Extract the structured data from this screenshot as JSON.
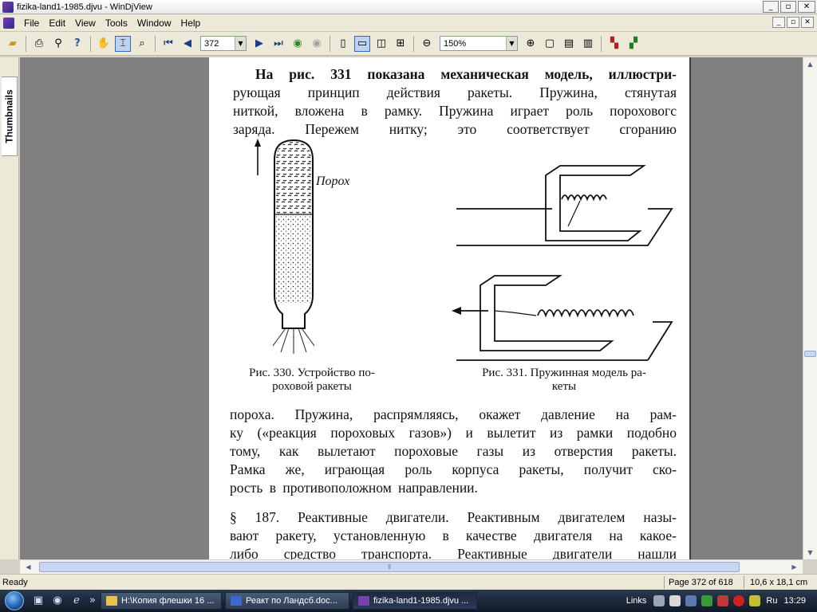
{
  "window": {
    "title": "fizika-land1-1985.djvu - WinDjView"
  },
  "window_buttons": {
    "minimize": "_",
    "maximize": "▫",
    "close": "✕"
  },
  "menu": [
    "File",
    "Edit",
    "View",
    "Tools",
    "Window",
    "Help"
  ],
  "toolbar": {
    "page_number": "372",
    "zoom": "150%"
  },
  "sidebar": {
    "tab_label": "Thumbnails"
  },
  "document": {
    "para1": [
      "На рис. 331 показана механическая модель, иллюстри-",
      "рующая принцип действия ракеты. Пружина, стянутая",
      "ниткой, вложена в рамку. Пружина играет роль пороховогс",
      "заряда. Пережем нитку; это соответствует сгоранию"
    ],
    "fig330_label": "Порох",
    "fig330_caption": [
      "Рис. 330. Устройство по-",
      "роховой ракеты"
    ],
    "fig331_caption": [
      "Рис. 331.  Пружинная  модель ра-",
      "кеты"
    ],
    "para2": [
      "пороха. Пружина, распрямляясь, окажет давление на  рам-",
      "ку («реакция пороховых газов») и вылетит из рамки подобно",
      "тому, как вылетают пороховые газы из отверстия ракеты.",
      "Рамка же, играющая роль корпуса ракеты, получит ско-",
      "рость  в  противоположном  направлении."
    ],
    "para3": [
      "§ 187. Реактивные двигатели. Реактивным двигателем назы-",
      "вают ракету, установленную в качестве двигателя на какое-",
      "либо средство транспорта. Реактивные двигатели нашли"
    ]
  },
  "status": {
    "left": "Ready",
    "page": "Page 372 of 618",
    "size": "10,6 x 18,1 cm"
  },
  "taskbar": {
    "tasks": [
      "H:\\Копия флешки 16 ...",
      "Реакт по Ландсб.doc...",
      "fizika-land1-1985.djvu ..."
    ],
    "links": "Links",
    "lang": "Ru",
    "clock": "13:29"
  }
}
